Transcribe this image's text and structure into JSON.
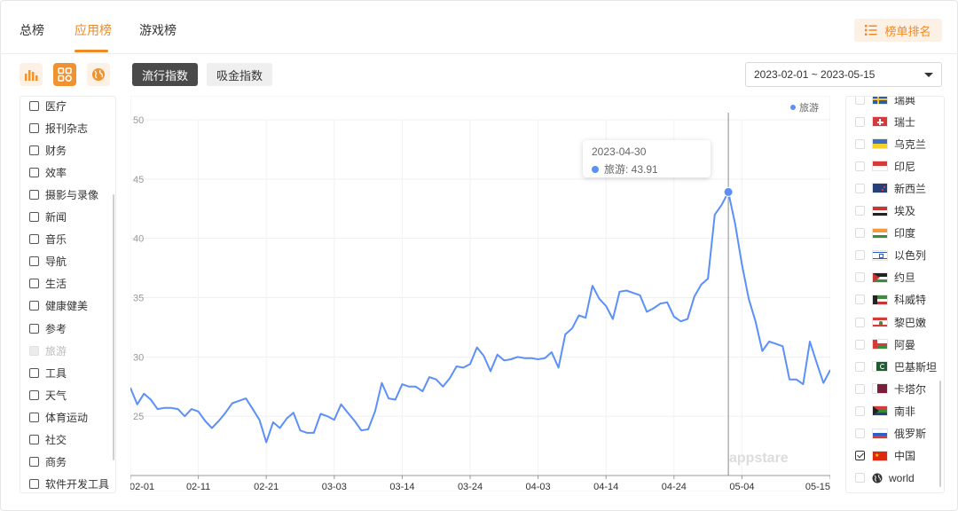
{
  "nav": {
    "tabs": [
      "总榜",
      "应用榜",
      "游戏榜"
    ],
    "active_tab": "应用榜",
    "rank_button": "榜单排名"
  },
  "toolbar": {
    "icons": [
      "bar-chart-icon",
      "grid-icon",
      "globe-icon"
    ],
    "segment": [
      "流行指数",
      "吸金指数"
    ],
    "date_range": "2023-02-01 ~ 2023-05-15"
  },
  "categories": [
    {
      "label": "医疗",
      "disabled": false
    },
    {
      "label": "报刊杂志",
      "disabled": false
    },
    {
      "label": "财务",
      "disabled": false
    },
    {
      "label": "效率",
      "disabled": false
    },
    {
      "label": "摄影与录像",
      "disabled": false
    },
    {
      "label": "新闻",
      "disabled": false
    },
    {
      "label": "音乐",
      "disabled": false
    },
    {
      "label": "导航",
      "disabled": false
    },
    {
      "label": "生活",
      "disabled": false
    },
    {
      "label": "健康健美",
      "disabled": false
    },
    {
      "label": "参考",
      "disabled": false
    },
    {
      "label": "旅游",
      "disabled": true
    },
    {
      "label": "工具",
      "disabled": false
    },
    {
      "label": "天气",
      "disabled": false
    },
    {
      "label": "体育运动",
      "disabled": false
    },
    {
      "label": "社交",
      "disabled": false
    },
    {
      "label": "商务",
      "disabled": false
    },
    {
      "label": "软件开发工具",
      "disabled": false
    }
  ],
  "countries": [
    {
      "label": "瑞典",
      "flag": "sweden",
      "checked": false
    },
    {
      "label": "瑞士",
      "flag": "switzerland",
      "checked": false
    },
    {
      "label": "乌克兰",
      "flag": "ukraine",
      "checked": false
    },
    {
      "label": "印尼",
      "flag": "indonesia",
      "checked": false
    },
    {
      "label": "新西兰",
      "flag": "new-zealand",
      "checked": false
    },
    {
      "label": "埃及",
      "flag": "egypt",
      "checked": false
    },
    {
      "label": "印度",
      "flag": "india",
      "checked": false
    },
    {
      "label": "以色列",
      "flag": "israel",
      "checked": false
    },
    {
      "label": "约旦",
      "flag": "jordan",
      "checked": false
    },
    {
      "label": "科威特",
      "flag": "kuwait",
      "checked": false
    },
    {
      "label": "黎巴嫩",
      "flag": "lebanon",
      "checked": false
    },
    {
      "label": "阿曼",
      "flag": "oman",
      "checked": false
    },
    {
      "label": "巴基斯坦",
      "flag": "pakistan",
      "checked": false
    },
    {
      "label": "卡塔尔",
      "flag": "qatar",
      "checked": false
    },
    {
      "label": "南非",
      "flag": "south-africa",
      "checked": false
    },
    {
      "label": "俄罗斯",
      "flag": "russia",
      "checked": false
    },
    {
      "label": "中国",
      "flag": "china",
      "checked": true
    },
    {
      "label": "world",
      "flag": "globe",
      "checked": false
    }
  ],
  "tooltip": {
    "date": "2023-04-30",
    "label": "旅游: 43.91"
  },
  "watermark": "appstare",
  "colors": {
    "accent": "#f08a24",
    "line": "#5b8ff9"
  },
  "chart_data": {
    "type": "line",
    "title": "",
    "xlabel": "",
    "ylabel": "",
    "ylim": [
      20,
      50
    ],
    "yticks": [
      "50",
      "45",
      "40",
      "35",
      "30",
      "25"
    ],
    "x_ticks": [
      "02-01",
      "02-11",
      "02-21",
      "03-03",
      "03-14",
      "03-24",
      "04-03",
      "04-14",
      "04-24",
      "05-04",
      "05-15"
    ],
    "legend": "top-right",
    "grid": true,
    "series": [
      {
        "name": "旅游",
        "values": [
          27.4,
          26.0,
          26.9,
          26.4,
          25.6,
          25.7,
          25.7,
          25.6,
          25.0,
          25.6,
          25.4,
          24.6,
          24.0,
          24.6,
          25.3,
          26.1,
          26.3,
          26.5,
          25.6,
          24.7,
          22.8,
          24.5,
          24.0,
          24.8,
          25.3,
          23.8,
          23.6,
          23.6,
          25.2,
          25.0,
          24.7,
          26.0,
          25.3,
          24.6,
          23.8,
          23.9,
          25.4,
          27.8,
          26.5,
          26.4,
          27.7,
          27.5,
          27.5,
          27.1,
          28.3,
          28.1,
          27.5,
          28.2,
          29.2,
          29.1,
          29.4,
          30.8,
          30.1,
          28.8,
          30.2,
          29.7,
          29.8,
          30.0,
          29.9,
          29.9,
          29.8,
          29.9,
          30.4,
          29.1,
          31.9,
          32.4,
          33.5,
          33.3,
          36.0,
          34.9,
          34.3,
          33.2,
          35.5,
          35.6,
          35.4,
          35.2,
          33.8,
          34.1,
          34.5,
          34.6,
          33.4,
          33.0,
          33.2,
          35.1,
          36.1,
          36.6,
          42.0,
          42.8,
          43.9,
          41.2,
          37.8,
          34.9,
          33.0,
          30.5,
          31.3,
          31.1,
          30.9,
          28.1,
          28.1,
          27.7,
          31.3,
          29.5,
          27.8,
          28.9
        ]
      }
    ],
    "highlight": {
      "x": "2023-04-30",
      "value": 43.91
    }
  }
}
